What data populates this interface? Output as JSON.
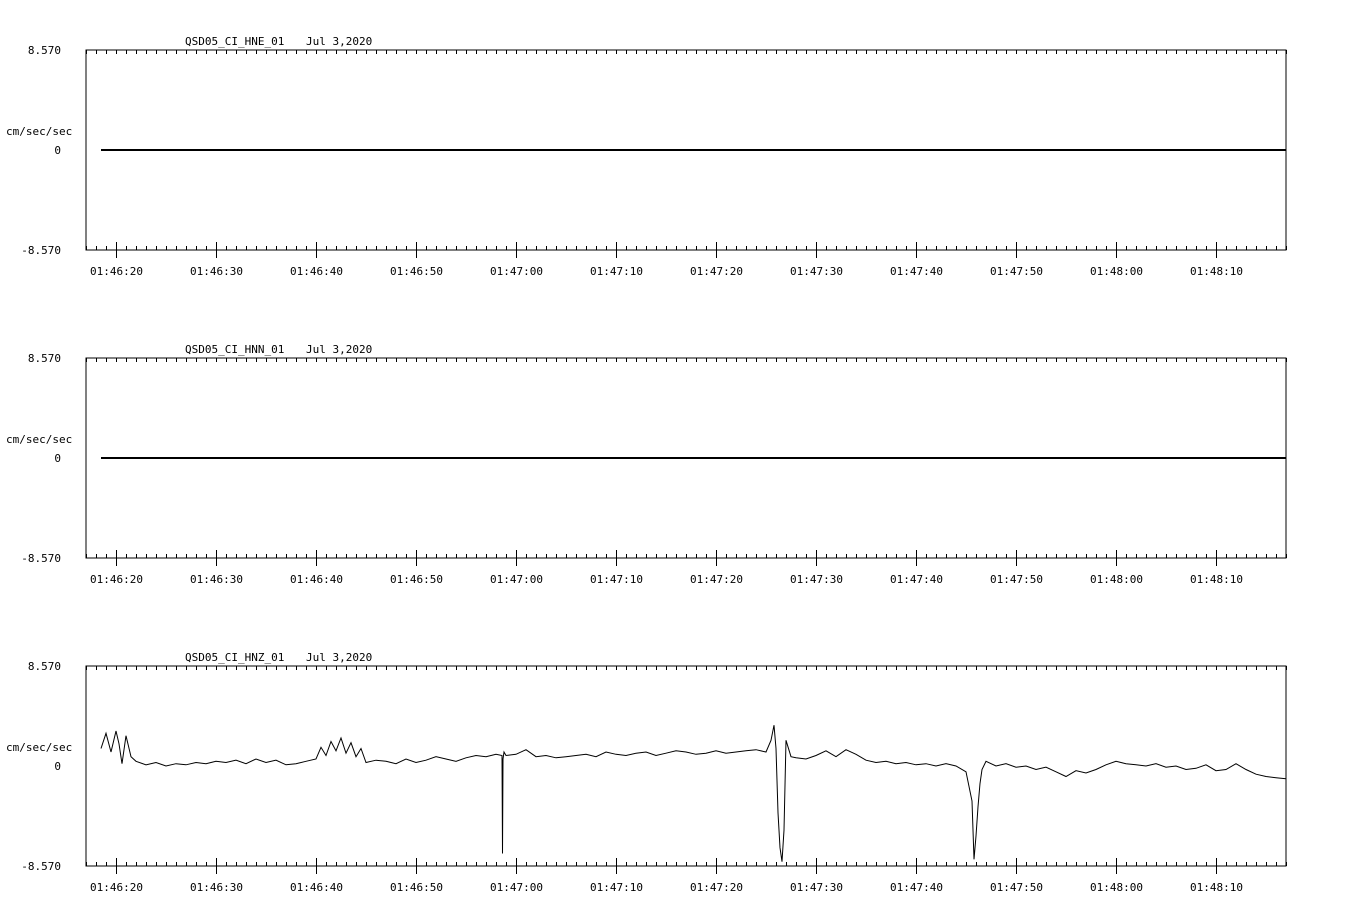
{
  "chart_data": [
    {
      "type": "line",
      "title": "QSD05_CI_HNE_01",
      "date": "Jul 3,2020",
      "ylabel": "cm/sec/sec",
      "ylim": [
        -8.57,
        8.57
      ],
      "ytick_labels": [
        "8.570",
        "0",
        "-8.570"
      ],
      "xlim_seconds": [
        17.0,
        137.0
      ],
      "x_tick_labels": [
        "01:46:20",
        "01:46:30",
        "01:46:40",
        "01:46:50",
        "01:47:00",
        "01:47:10",
        "01:47:20",
        "01:47:30",
        "01:47:40",
        "01:47:50",
        "01:48:00",
        "01:48:10"
      ],
      "grid": false,
      "series": [
        {
          "values_t": [
            18.5,
            137.0
          ],
          "values_y": [
            0.0,
            0.0
          ]
        }
      ]
    },
    {
      "type": "line",
      "title": "QSD05_CI_HNN_01",
      "date": "Jul 3,2020",
      "ylabel": "cm/sec/sec",
      "ylim": [
        -8.57,
        8.57
      ],
      "ytick_labels": [
        "8.570",
        "0",
        "-8.570"
      ],
      "xlim_seconds": [
        17.0,
        137.0
      ],
      "x_tick_labels": [
        "01:46:20",
        "01:46:30",
        "01:46:40",
        "01:46:50",
        "01:47:00",
        "01:47:10",
        "01:47:20",
        "01:47:30",
        "01:47:40",
        "01:47:50",
        "01:48:00",
        "01:48:10"
      ],
      "grid": false,
      "series": [
        {
          "values_t": [
            18.5,
            137.0
          ],
          "values_y": [
            0.0,
            0.0
          ]
        }
      ]
    },
    {
      "type": "line",
      "title": "QSD05_CI_HNZ_01",
      "date": "Jul 3,2020",
      "ylabel": "cm/sec/sec",
      "ylim": [
        -8.57,
        8.57
      ],
      "ytick_labels": [
        "8.570",
        "0",
        "-8.570"
      ],
      "xlim_seconds": [
        17.0,
        137.0
      ],
      "x_tick_labels": [
        "01:46:20",
        "01:46:30",
        "01:46:40",
        "01:46:50",
        "01:47:00",
        "01:47:10",
        "01:47:20",
        "01:47:30",
        "01:47:40",
        "01:47:50",
        "01:48:00",
        "01:48:10"
      ],
      "grid": false,
      "series": [
        {
          "values_t": [
            18.5,
            19.0,
            19.5,
            20.0,
            20.3,
            20.6,
            21.0,
            21.5,
            22.0,
            23.0,
            24.0,
            25.0,
            26.0,
            27.0,
            28.0,
            29.0,
            30.0,
            31.0,
            32.0,
            33.0,
            34.0,
            35.0,
            36.0,
            37.0,
            38.0,
            39.0,
            40.0,
            40.5,
            41.0,
            41.5,
            42.0,
            42.5,
            43.0,
            43.5,
            44.0,
            44.5,
            45.0,
            46.0,
            47.0,
            48.0,
            49.0,
            50.0,
            51.0,
            52.0,
            53.0,
            54.0,
            55.0,
            56.0,
            57.0,
            58.0,
            58.6,
            58.65,
            58.7,
            58.8,
            59.0,
            60.0,
            61.0,
            62.0,
            63.0,
            64.0,
            65.0,
            66.0,
            67.0,
            68.0,
            69.0,
            70.0,
            71.0,
            72.0,
            73.0,
            74.0,
            75.0,
            76.0,
            77.0,
            78.0,
            79.0,
            80.0,
            81.0,
            82.0,
            83.0,
            84.0,
            85.0,
            85.5,
            85.8,
            86.0,
            86.2,
            86.4,
            86.6,
            86.8,
            87.0,
            87.5,
            88.0,
            89.0,
            90.0,
            91.0,
            92.0,
            93.0,
            94.0,
            95.0,
            96.0,
            97.0,
            98.0,
            99.0,
            100.0,
            101.0,
            102.0,
            103.0,
            104.0,
            105.0,
            105.6,
            105.8,
            106.0,
            106.2,
            106.4,
            106.6,
            107.0,
            108.0,
            109.0,
            110.0,
            111.0,
            112.0,
            113.0,
            114.0,
            115.0,
            116.0,
            117.0,
            118.0,
            119.0,
            120.0,
            121.0,
            122.0,
            123.0,
            124.0,
            125.0,
            126.0,
            127.0,
            128.0,
            129.0,
            130.0,
            131.0,
            132.0,
            133.0,
            134.0,
            135.0,
            136.0,
            137.0
          ],
          "values_y": [
            1.5,
            2.8,
            1.2,
            3.0,
            1.9,
            0.2,
            2.6,
            0.8,
            0.4,
            0.1,
            0.3,
            0.0,
            0.2,
            0.1,
            0.3,
            0.2,
            0.4,
            0.3,
            0.5,
            0.2,
            0.6,
            0.3,
            0.5,
            0.1,
            0.2,
            0.4,
            0.6,
            1.6,
            0.9,
            2.1,
            1.3,
            2.4,
            1.1,
            2.0,
            0.8,
            1.5,
            0.3,
            0.5,
            0.4,
            0.2,
            0.6,
            0.3,
            0.5,
            0.8,
            0.6,
            0.4,
            0.7,
            0.9,
            0.8,
            1.0,
            0.9,
            -7.5,
            0.6,
            1.2,
            0.9,
            1.0,
            1.4,
            0.8,
            0.9,
            0.7,
            0.8,
            0.9,
            1.0,
            0.8,
            1.2,
            1.0,
            0.9,
            1.1,
            1.2,
            0.9,
            1.1,
            1.3,
            1.2,
            1.0,
            1.1,
            1.3,
            1.1,
            1.2,
            1.3,
            1.4,
            1.2,
            2.2,
            3.5,
            1.5,
            -4.0,
            -7.0,
            -8.2,
            -5.5,
            2.2,
            0.8,
            0.7,
            0.6,
            0.9,
            1.3,
            0.8,
            1.4,
            1.0,
            0.5,
            0.3,
            0.4,
            0.2,
            0.3,
            0.1,
            0.2,
            0.0,
            0.2,
            0.0,
            -0.5,
            -3.0,
            -8.0,
            -6.0,
            -3.5,
            -1.5,
            -0.3,
            0.4,
            0.0,
            0.2,
            -0.1,
            0.0,
            -0.3,
            -0.1,
            -0.5,
            -0.9,
            -0.4,
            -0.6,
            -0.3,
            0.1,
            0.4,
            0.2,
            0.1,
            0.0,
            0.2,
            -0.1,
            0.0,
            -0.3,
            -0.2,
            0.1,
            -0.4,
            -0.3,
            0.2,
            -0.3,
            -0.7,
            -0.9,
            -1.0,
            -1.1,
            -1.1,
            -1.2
          ]
        }
      ]
    }
  ]
}
